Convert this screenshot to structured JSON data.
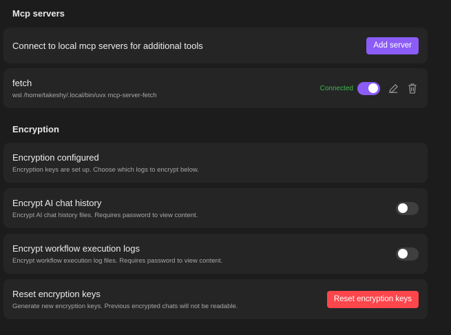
{
  "mcp": {
    "heading": "Mcp servers",
    "connect_text": "Connect to local mcp servers for additional tools",
    "add_label": "Add server",
    "server": {
      "name": "fetch",
      "command": "wsl /home/takeshy/.local/bin/uvx mcp-server-fetch",
      "status": "Connected",
      "enabled": true
    }
  },
  "encryption": {
    "heading": "Encryption",
    "configured": {
      "title": "Encryption configured",
      "desc": "Encryption keys are set up. Choose which logs to encrypt below."
    },
    "chat": {
      "title": "Encrypt AI chat history",
      "desc": "Encrypt AI chat history files. Requires password to view content.",
      "enabled": false
    },
    "workflow": {
      "title": "Encrypt workflow execution logs",
      "desc": "Encrypt workflow execution log files. Requires password to view content.",
      "enabled": false
    },
    "reset": {
      "title": "Reset encryption keys",
      "desc": "Generate new encryption keys. Previous encrypted chats will not be readable.",
      "button": "Reset encryption keys"
    }
  },
  "colors": {
    "accent": "#8b5cf6",
    "danger": "#fb464c",
    "success": "#3cb94c"
  }
}
